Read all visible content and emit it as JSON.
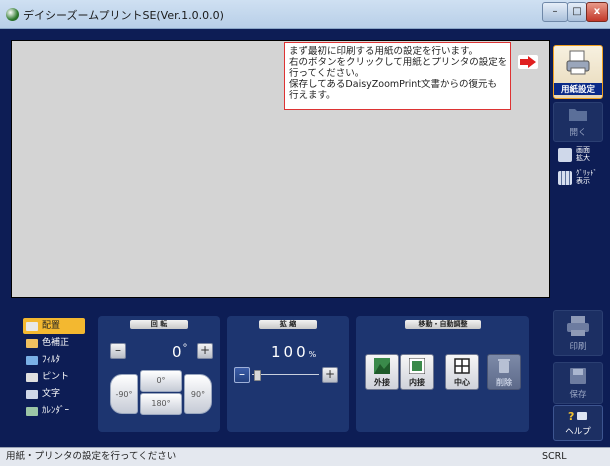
{
  "window": {
    "title": "デイシーズームプリントSE(Ver.1.0.0.0)",
    "controls": {
      "minimize": "–",
      "maximize": "□",
      "close": "x"
    }
  },
  "message": {
    "lines": [
      "まず最初に印刷する用紙の設定を行います。",
      "右のボタンをクリックして用紙とプリンタの設定を",
      "行ってください。",
      "保存してあるDaisyZoomPrint文書からの復元も",
      "行えます。"
    ]
  },
  "sidebar": {
    "paper_settings": "用紙設定",
    "open": "開く",
    "zoom_lines": [
      "画面",
      "拡大"
    ],
    "grid_lines": [
      "ｸﾞﾘｯﾄﾞ",
      "表示"
    ],
    "print": "印刷",
    "save": "保存",
    "help": "ヘルプ"
  },
  "modes": [
    {
      "label": "配置",
      "color": "#e8e8e8"
    },
    {
      "label": "色補正",
      "color": "#f0c060"
    },
    {
      "label": "ﾌｨﾙﾀ",
      "color": "#7ab0e6"
    },
    {
      "label": "ピント",
      "color": "#e0e0e0"
    },
    {
      "label": "文字",
      "color": "#d0d8e8"
    },
    {
      "label": "ｶﾚﾝﾀﾞｰ",
      "color": "#9cc6a6"
    }
  ],
  "rotation": {
    "header": "回 転",
    "value": "0",
    "unit": "°",
    "minus": "–",
    "plus": "+",
    "left_90": "-90°",
    "upright": "0°",
    "flip_180": "180°",
    "right_90": "90°"
  },
  "scale": {
    "header": "拡 縮",
    "value": "100",
    "unit": "%",
    "minus": "–",
    "plus": "+",
    "level": 0.0
  },
  "move": {
    "header": "移動・自動調整",
    "buttons": [
      "外接",
      "内接",
      "中心",
      "削除"
    ]
  },
  "status": {
    "text": "用紙・プリンタの設定を行ってください",
    "indicator": "SCRL"
  }
}
